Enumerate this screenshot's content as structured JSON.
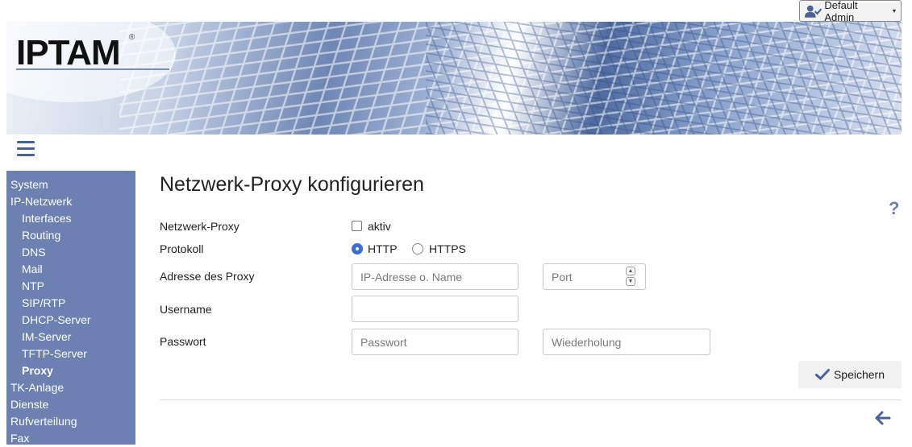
{
  "user_menu": {
    "label": "Default Admin",
    "caret": "▾",
    "icon": "user-check-icon"
  },
  "banner": {
    "logo_text": "IPTAM",
    "registered_mark": "®"
  },
  "sidebar": {
    "items": [
      {
        "label": "System",
        "level": 0
      },
      {
        "label": "IP-Netzwerk",
        "level": 0
      },
      {
        "label": "Interfaces",
        "level": 1
      },
      {
        "label": "Routing",
        "level": 1
      },
      {
        "label": "DNS",
        "level": 1
      },
      {
        "label": "Mail",
        "level": 1
      },
      {
        "label": "NTP",
        "level": 1
      },
      {
        "label": "SIP/RTP",
        "level": 1
      },
      {
        "label": "DHCP-Server",
        "level": 1
      },
      {
        "label": "IM-Server",
        "level": 1
      },
      {
        "label": "TFTP-Server",
        "level": 1
      },
      {
        "label": "Proxy",
        "level": 1,
        "active": true
      },
      {
        "label": "TK-Anlage",
        "level": 0
      },
      {
        "label": "Dienste",
        "level": 0
      },
      {
        "label": "Rufverteilung",
        "level": 0
      },
      {
        "label": "Fax",
        "level": 0
      }
    ]
  },
  "main": {
    "title": "Netzwerk-Proxy konfigurieren",
    "help": "?",
    "form": {
      "proxy_label": "Netzwerk-Proxy",
      "proxy_active_label": "aktiv",
      "proxy_active_checked": false,
      "protocol_label": "Protokoll",
      "protocol_options": [
        "HTTP",
        "HTTPS"
      ],
      "protocol_selected": "HTTP",
      "address_label": "Adresse des Proxy",
      "address_placeholder": "IP-Adresse o. Name",
      "address_value": "",
      "port_placeholder": "Port",
      "port_value": "",
      "username_label": "Username",
      "username_value": "",
      "password_label": "Passwort",
      "password_placeholder": "Passwort",
      "password_repeat_placeholder": "Wiederholung"
    },
    "save_label": "Speichern"
  },
  "colors": {
    "sidebar_bg": "#6c81b1",
    "accent": "#4a6397",
    "radio_selected": "#3a6fd0"
  }
}
